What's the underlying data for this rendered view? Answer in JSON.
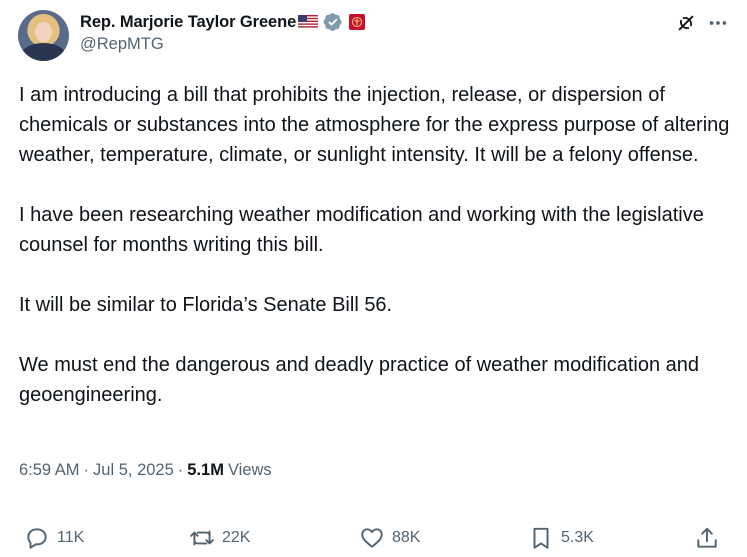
{
  "author": {
    "name": "Rep. Marjorie Taylor Greene",
    "handle": "@RepMTG"
  },
  "icons": {
    "flag": "us-flag-icon",
    "verified": "gray-verified-badge-icon",
    "affiliate": "house-affiliate-badge-icon",
    "grok": "grok-icon",
    "more": "more-icon"
  },
  "tweet": {
    "paragraphs": [
      "I am introducing a bill that prohibits the injection, release, or dispersion of chemicals or substances into the atmosphere for the express purpose of altering weather, temperature, climate, or sunlight intensity. It will be a felony offense.",
      "I have been researching weather modification and working with the legislative counsel for months writing this bill.",
      "It will be similar to Florida’s Senate Bill 56.",
      "We must end the dangerous and deadly practice of weather modification and geoengineering."
    ]
  },
  "meta": {
    "time": "6:59 AM",
    "date": "Jul 5, 2025",
    "views_count": "5.1M",
    "views_label": "Views"
  },
  "actions": {
    "replies": "11K",
    "reposts": "22K",
    "likes": "88K",
    "bookmarks": "5.3K"
  },
  "colors": {
    "text": "#0f1419",
    "secondary": "#536471",
    "verified_gray": "#829aab",
    "badge_red": "#c8102e"
  }
}
